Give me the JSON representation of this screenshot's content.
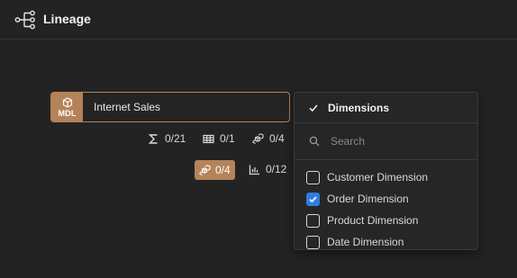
{
  "header": {
    "title": "Lineage"
  },
  "node": {
    "badge": "MDL",
    "name": "Internet Sales"
  },
  "stats": {
    "measures": "0/21",
    "tables": "0/1",
    "dimensions": "0/4",
    "dimensions_selected": "0/4",
    "metrics": "0/12"
  },
  "dropdown": {
    "title": "Dimensions",
    "search_placeholder": "Search",
    "items": [
      {
        "label": "Customer Dimension",
        "checked": false
      },
      {
        "label": "Order Dimension",
        "checked": true
      },
      {
        "label": "Product Dimension",
        "checked": false
      },
      {
        "label": "Date Dimension",
        "checked": false
      }
    ]
  },
  "colors": {
    "accent": "#b5835a",
    "checkbox_checked": "#2f7de1",
    "background": "#232323"
  },
  "icons": {
    "header": "lineage-icon",
    "badge": "cube-icon",
    "measures": "sigma-icon",
    "tables": "table-icon",
    "dimensions": "cubes-icon",
    "metrics": "bar-chart-icon",
    "search": "search-icon"
  }
}
